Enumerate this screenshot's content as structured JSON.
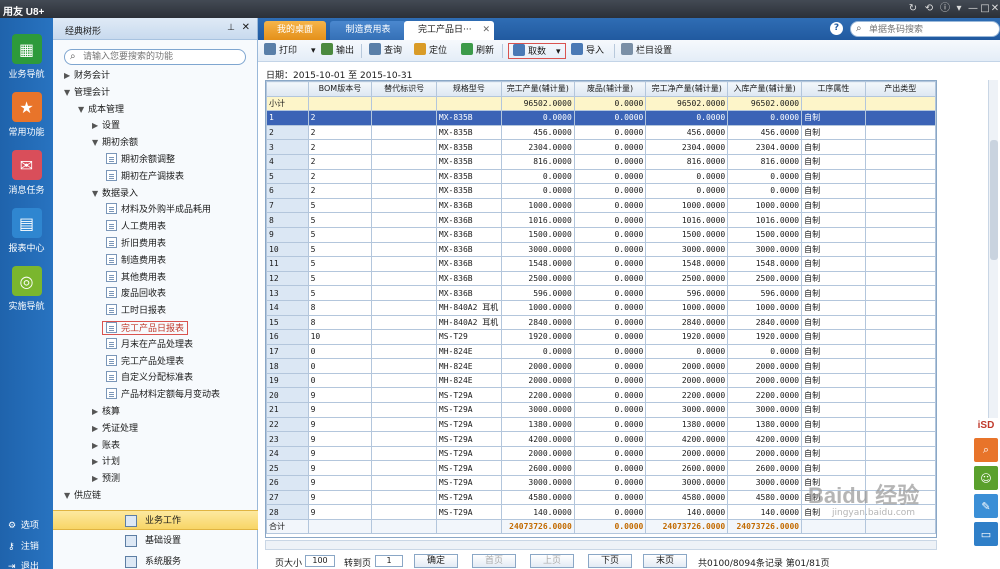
{
  "app": {
    "title": "用友 U8+"
  },
  "window_controls": [
    "↻",
    "⟲",
    "ⓘ",
    "▾",
    "—",
    "□",
    "✕"
  ],
  "leftnav": {
    "items": [
      {
        "label": "业务导航",
        "color": "#2d9a3b",
        "icon": "grid-icon"
      },
      {
        "label": "常用功能",
        "color": "#e8742a",
        "icon": "star-icon"
      },
      {
        "label": "消息任务",
        "color": "#d94e5a",
        "icon": "mail-icon"
      },
      {
        "label": "报表中心",
        "color": "#2f86d0",
        "icon": "report-icon"
      },
      {
        "label": "实施导航",
        "color": "#7ab62e",
        "icon": "compass-icon"
      }
    ],
    "bottom": [
      {
        "label": "选项",
        "icon": "gear-icon"
      },
      {
        "label": "注销",
        "icon": "key-icon"
      },
      {
        "label": "退出",
        "icon": "exit-icon"
      }
    ]
  },
  "tree": {
    "title": "经典树形",
    "search_placeholder": "请输入您要搜索的功能",
    "nodes": [
      {
        "label": "财务会计",
        "level": 0,
        "arrow": "▶"
      },
      {
        "label": "管理会计",
        "level": 0,
        "arrow": "▼"
      },
      {
        "label": "成本管理",
        "level": 1,
        "arrow": "▼"
      },
      {
        "label": "设置",
        "level": 2,
        "arrow": "▶"
      },
      {
        "label": "期初余额",
        "level": 2,
        "arrow": "▼"
      },
      {
        "label": "期初余额调整",
        "level": 3,
        "doc": true
      },
      {
        "label": "期初在产调拨表",
        "level": 3,
        "doc": true
      },
      {
        "label": "数据录入",
        "level": 2,
        "arrow": "▼"
      },
      {
        "label": "材料及外购半成品耗用",
        "level": 3,
        "doc": true
      },
      {
        "label": "人工费用表",
        "level": 3,
        "doc": true
      },
      {
        "label": "折旧费用表",
        "level": 3,
        "doc": true
      },
      {
        "label": "制造费用表",
        "level": 3,
        "doc": true
      },
      {
        "label": "其他费用表",
        "level": 3,
        "doc": true
      },
      {
        "label": "废品回收表",
        "level": 3,
        "doc": true
      },
      {
        "label": "工时日报表",
        "level": 3,
        "doc": true
      },
      {
        "label": "完工产品日报表",
        "level": 3,
        "doc": true,
        "highlight": true
      },
      {
        "label": "月末在产品处理表",
        "level": 3,
        "doc": true
      },
      {
        "label": "完工产品处理表",
        "level": 3,
        "doc": true
      },
      {
        "label": "自定义分配标准表",
        "level": 3,
        "doc": true
      },
      {
        "label": "产品材料定额每月变动表",
        "level": 3,
        "doc": true
      },
      {
        "label": "核算",
        "level": 2,
        "arrow": "▶"
      },
      {
        "label": "凭证处理",
        "level": 2,
        "arrow": "▶"
      },
      {
        "label": "账表",
        "level": 2,
        "arrow": "▶"
      },
      {
        "label": "计划",
        "level": 2,
        "arrow": "▶"
      },
      {
        "label": "预测",
        "level": 2,
        "arrow": "▶"
      },
      {
        "label": "供应链",
        "level": 0,
        "arrow": "▼"
      }
    ],
    "bottom": [
      {
        "label": "业务工作",
        "selected": true
      },
      {
        "label": "基础设置",
        "selected": false
      },
      {
        "label": "系统服务",
        "selected": false
      }
    ]
  },
  "tabs": [
    {
      "label": "我的桌面",
      "style": "orange"
    },
    {
      "label": "制造费用表",
      "style": "blue"
    },
    {
      "label": "完工产品日···",
      "style": "active",
      "close": "✕"
    }
  ],
  "barcode_placeholder": "单据条码搜索",
  "help": "?",
  "toolbar": [
    {
      "label": "打印",
      "dropdown": true,
      "color": "#5a7fa8"
    },
    {
      "label": "输出",
      "color": "#4c8a3f"
    },
    {
      "label": "查询",
      "color": "#5a7fa8"
    },
    {
      "label": "定位",
      "color": "#d99b27"
    },
    {
      "label": "刷新",
      "color": "#3c9a4a"
    },
    {
      "label": "取数",
      "dropdown": true,
      "boxed": true,
      "color": "#4a79b5"
    },
    {
      "label": "导入",
      "color": "#4a79b5"
    },
    {
      "label": "栏目设置",
      "color": "#7a8fa6"
    }
  ],
  "date_label": "日期：2015-10-01 至 2015-10-31",
  "grid": {
    "columns": [
      "",
      "BOM版本号",
      "替代标识号",
      "规格型号",
      "完工产量(辅计量)",
      "废品(辅计量)",
      "完工净产量(辅计量)",
      "入库产量(辅计量)",
      "工序属性",
      "产出类型"
    ],
    "subtotal": {
      "label": "小计",
      "values": [
        "",
        "",
        "",
        "96502.0000",
        "0.0000",
        "96502.0000",
        "96502.0000",
        "",
        ""
      ]
    },
    "rows": [
      [
        "1",
        "2",
        "",
        "MX-835B",
        "0.0000",
        "0.0000",
        "0.0000",
        "0.0000",
        "自制",
        ""
      ],
      [
        "2",
        "2",
        "",
        "MX-835B",
        "456.0000",
        "0.0000",
        "456.0000",
        "456.0000",
        "自制",
        ""
      ],
      [
        "3",
        "2",
        "",
        "MX-835B",
        "2304.0000",
        "0.0000",
        "2304.0000",
        "2304.0000",
        "自制",
        ""
      ],
      [
        "4",
        "2",
        "",
        "MX-835B",
        "816.0000",
        "0.0000",
        "816.0000",
        "816.0000",
        "自制",
        ""
      ],
      [
        "5",
        "2",
        "",
        "MX-835B",
        "0.0000",
        "0.0000",
        "0.0000",
        "0.0000",
        "自制",
        ""
      ],
      [
        "6",
        "2",
        "",
        "MX-835B",
        "0.0000",
        "0.0000",
        "0.0000",
        "0.0000",
        "自制",
        ""
      ],
      [
        "7",
        "5",
        "",
        "MX-836B",
        "1000.0000",
        "0.0000",
        "1000.0000",
        "1000.0000",
        "自制",
        ""
      ],
      [
        "8",
        "5",
        "",
        "MX-836B",
        "1016.0000",
        "0.0000",
        "1016.0000",
        "1016.0000",
        "自制",
        ""
      ],
      [
        "9",
        "5",
        "",
        "MX-836B",
        "1500.0000",
        "0.0000",
        "1500.0000",
        "1500.0000",
        "自制",
        ""
      ],
      [
        "10",
        "5",
        "",
        "MX-836B",
        "3000.0000",
        "0.0000",
        "3000.0000",
        "3000.0000",
        "自制",
        ""
      ],
      [
        "11",
        "5",
        "",
        "MX-836B",
        "1548.0000",
        "0.0000",
        "1548.0000",
        "1548.0000",
        "自制",
        ""
      ],
      [
        "12",
        "5",
        "",
        "MX-836B",
        "2500.0000",
        "0.0000",
        "2500.0000",
        "2500.0000",
        "自制",
        ""
      ],
      [
        "13",
        "5",
        "",
        "MX-836B",
        "596.0000",
        "0.0000",
        "596.0000",
        "596.0000",
        "自制",
        ""
      ],
      [
        "14",
        "8",
        "",
        "MH-840A2 耳机",
        "1000.0000",
        "0.0000",
        "1000.0000",
        "1000.0000",
        "自制",
        ""
      ],
      [
        "15",
        "8",
        "",
        "MH-840A2 耳机",
        "2840.0000",
        "0.0000",
        "2840.0000",
        "2840.0000",
        "自制",
        ""
      ],
      [
        "16",
        "10",
        "",
        "MS-T29",
        "1920.0000",
        "0.0000",
        "1920.0000",
        "1920.0000",
        "自制",
        ""
      ],
      [
        "17",
        "0",
        "",
        "MH-824E",
        "0.0000",
        "0.0000",
        "0.0000",
        "0.0000",
        "自制",
        ""
      ],
      [
        "18",
        "0",
        "",
        "MH-824E",
        "2000.0000",
        "0.0000",
        "2000.0000",
        "2000.0000",
        "自制",
        ""
      ],
      [
        "19",
        "0",
        "",
        "MH-824E",
        "2000.0000",
        "0.0000",
        "2000.0000",
        "2000.0000",
        "自制",
        ""
      ],
      [
        "20",
        "9",
        "",
        "MS-T29A",
        "2200.0000",
        "0.0000",
        "2200.0000",
        "2200.0000",
        "自制",
        ""
      ],
      [
        "21",
        "9",
        "",
        "MS-T29A",
        "3000.0000",
        "0.0000",
        "3000.0000",
        "3000.0000",
        "自制",
        ""
      ],
      [
        "22",
        "9",
        "",
        "MS-T29A",
        "1380.0000",
        "0.0000",
        "1380.0000",
        "1380.0000",
        "自制",
        ""
      ],
      [
        "23",
        "9",
        "",
        "MS-T29A",
        "4200.0000",
        "0.0000",
        "4200.0000",
        "4200.0000",
        "自制",
        ""
      ],
      [
        "24",
        "9",
        "",
        "MS-T29A",
        "2000.0000",
        "0.0000",
        "2000.0000",
        "2000.0000",
        "自制",
        ""
      ],
      [
        "25",
        "9",
        "",
        "MS-T29A",
        "2600.0000",
        "0.0000",
        "2600.0000",
        "2600.0000",
        "自制",
        ""
      ],
      [
        "26",
        "9",
        "",
        "MS-T29A",
        "3000.0000",
        "0.0000",
        "3000.0000",
        "3000.0000",
        "自制",
        ""
      ],
      [
        "27",
        "9",
        "",
        "MS-T29A",
        "4580.0000",
        "0.0000",
        "4580.0000",
        "4580.0000",
        "自制",
        ""
      ],
      [
        "28",
        "9",
        "",
        "MS-T29A",
        "140.0000",
        "0.0000",
        "140.0000",
        "140.0000",
        "自制",
        ""
      ]
    ],
    "total": {
      "label": "合计",
      "values": [
        "",
        "",
        "",
        "24073726.0000",
        "0.0000",
        "24073726.0000",
        "24073726.0000",
        "",
        ""
      ]
    }
  },
  "pager": {
    "page_size_label": "页大小",
    "page_size": "100",
    "goto_label": "转到页",
    "goto_value": "1",
    "confirm": "确定",
    "first": "首页",
    "prev": "上页",
    "next": "下页",
    "last": "末页",
    "status": "共0100/8094条记录 第01/81页"
  },
  "side_widget": {
    "title": "iSD"
  },
  "watermark": {
    "main": "Baidu 经验",
    "sub": "jingyan.baidu.com"
  }
}
